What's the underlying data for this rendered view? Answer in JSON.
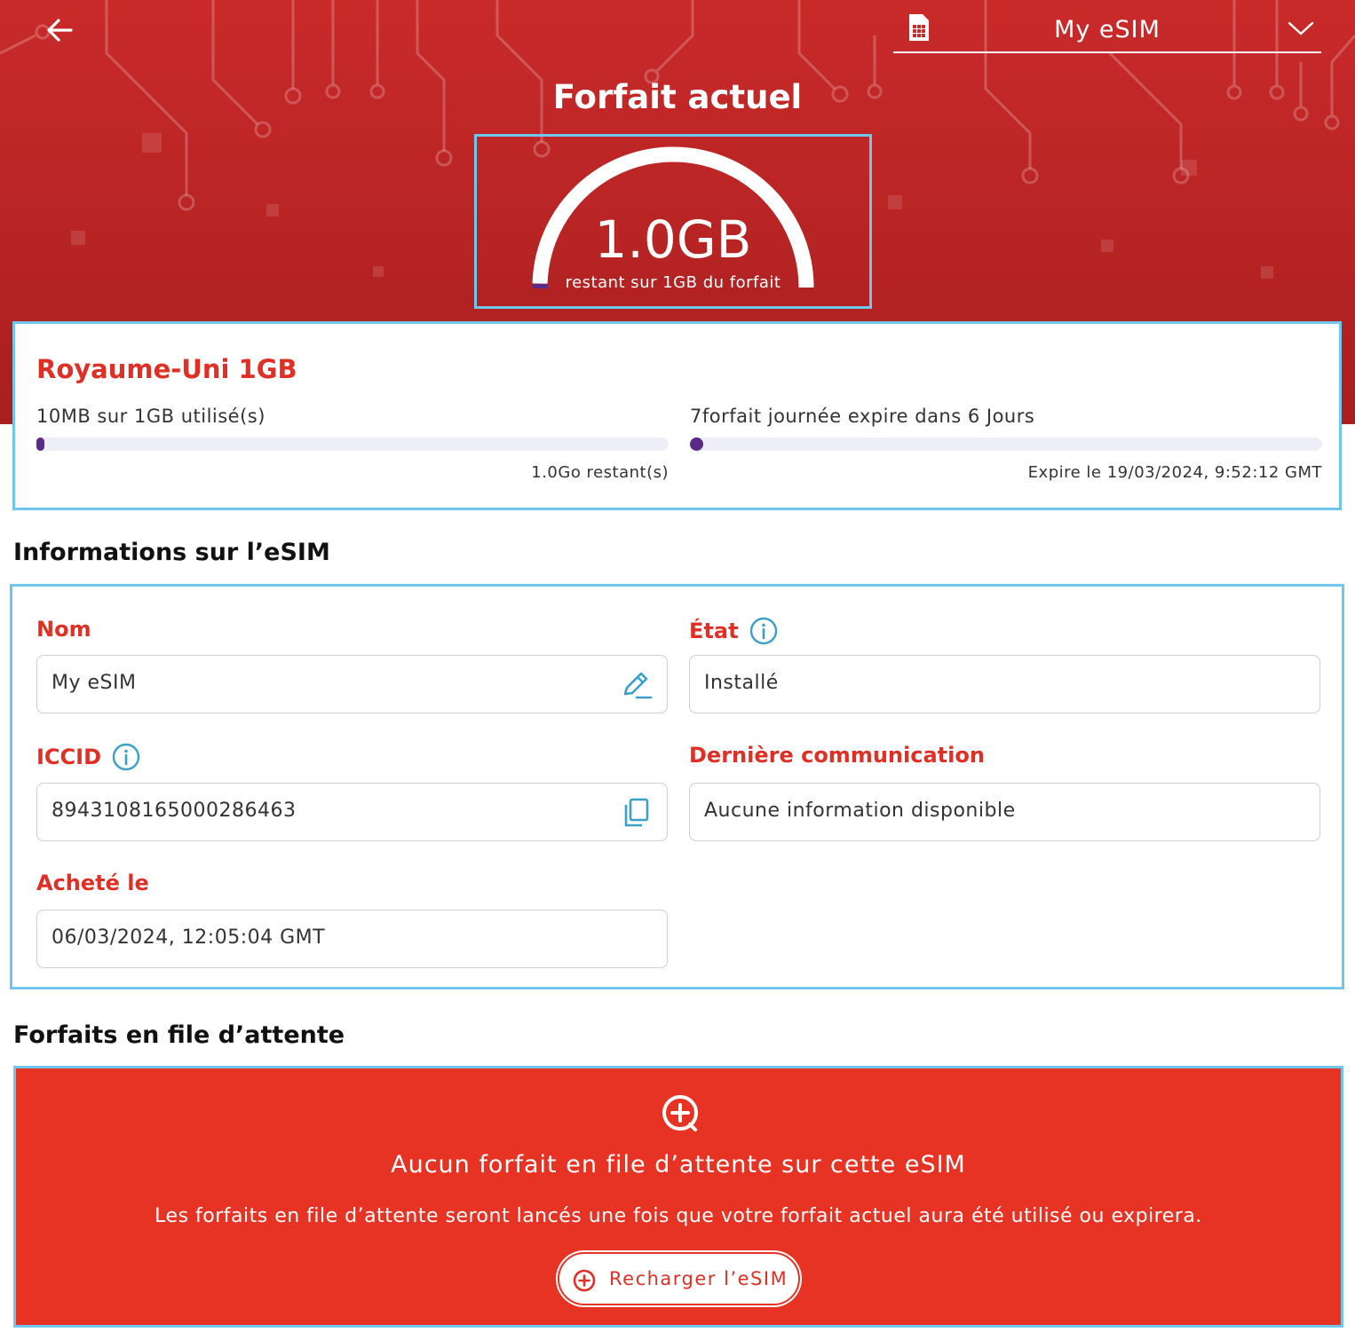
{
  "header": {
    "back_icon": "arrow-left-icon",
    "sim_icon": "sim-card-icon",
    "selected_esim": "My eSIM",
    "dropdown_icon": "chevron-down-icon",
    "title": "Forfait actuel"
  },
  "gauge": {
    "value": "1.0GB",
    "subtitle": "restant sur 1GB du forfait",
    "remaining_fraction": 0.99
  },
  "plan": {
    "name": "Royaume-Uni 1GB",
    "usage_label": "10MB sur 1GB utilisé(s)",
    "usage_fraction": 0.01,
    "remaining_label": "1.0Go restant(s)",
    "validity_label": "7forfait journée expire dans 6 Jours",
    "validity_fraction": 0.0,
    "expiry_label": "Expire le 19/03/2024, 9:52:12 GMT"
  },
  "esim_info": {
    "section_title": "Informations sur l’eSIM",
    "name_label": "Nom",
    "name_value": "My eSIM",
    "edit_icon": "edit-pencil-icon",
    "state_label": "État",
    "state_value": "Installé",
    "info_icon": "info-circle-icon",
    "iccid_label": "ICCID",
    "iccid_value": "8943108165000286463",
    "copy_icon": "copy-icon",
    "last_comm_label": "Dernière communication",
    "last_comm_value": "Aucune information disponible",
    "purchased_label": "Acheté le",
    "purchased_value": "06/03/2024, 12:05:04 GMT"
  },
  "queue": {
    "section_title": "Forfaits en file d’attente",
    "icon": "add-circle-icon",
    "title": "Aucun forfait en file d’attente sur cette eSIM",
    "description": "Les forfaits en file d’attente seront lancés une fois que votre forfait actuel aura été utilisé ou expirera.",
    "button_label": "Recharger l’eSIM"
  },
  "colors": {
    "brand_red": "#e03025",
    "hero_red": "#c92a2a",
    "highlight_blue": "#6fc7ee",
    "progress_purple": "#5b2a86"
  }
}
